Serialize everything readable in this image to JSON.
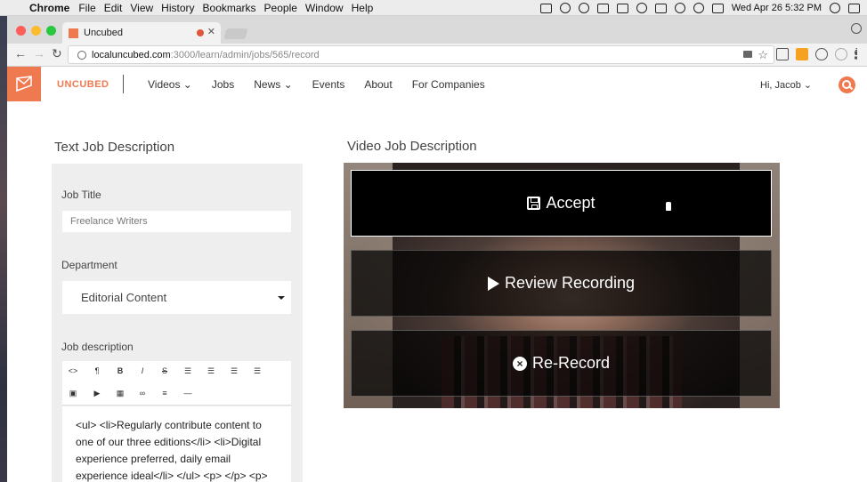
{
  "menubar": {
    "app": "Chrome",
    "items": [
      "File",
      "Edit",
      "View",
      "History",
      "Bookmarks",
      "People",
      "Window",
      "Help"
    ],
    "clock": "Wed Apr 26  5:32 PM"
  },
  "browser": {
    "tab_title": "Uncubed",
    "url_host": "localuncubed.com",
    "url_path": ":3000/learn/admin/jobs/565/record"
  },
  "site": {
    "brand": "UNCUBED",
    "nav": [
      "Videos ⌄",
      "Jobs",
      "News ⌄",
      "Events",
      "About",
      "For Companies"
    ],
    "greeting": "Hi, Jacob ⌄"
  },
  "left": {
    "heading": "Text Job Description",
    "job_title_label": "Job Title",
    "job_title_value": "Freelance Writers",
    "department_label": "Department",
    "department_value": "Editorial Content",
    "description_label": "Job description",
    "description_text": "<ul> <li>Regularly contribute content to one of our three editions</li> <li>Digital experience preferred, daily email experience ideal</li> </ul> <p> </p> <p>"
  },
  "right": {
    "heading": "Video Job Description",
    "accept_label": "Accept",
    "review_label": "Review Recording",
    "rerecord_label": "Re-Record"
  },
  "colors": {
    "brand": "#f07a4f"
  }
}
